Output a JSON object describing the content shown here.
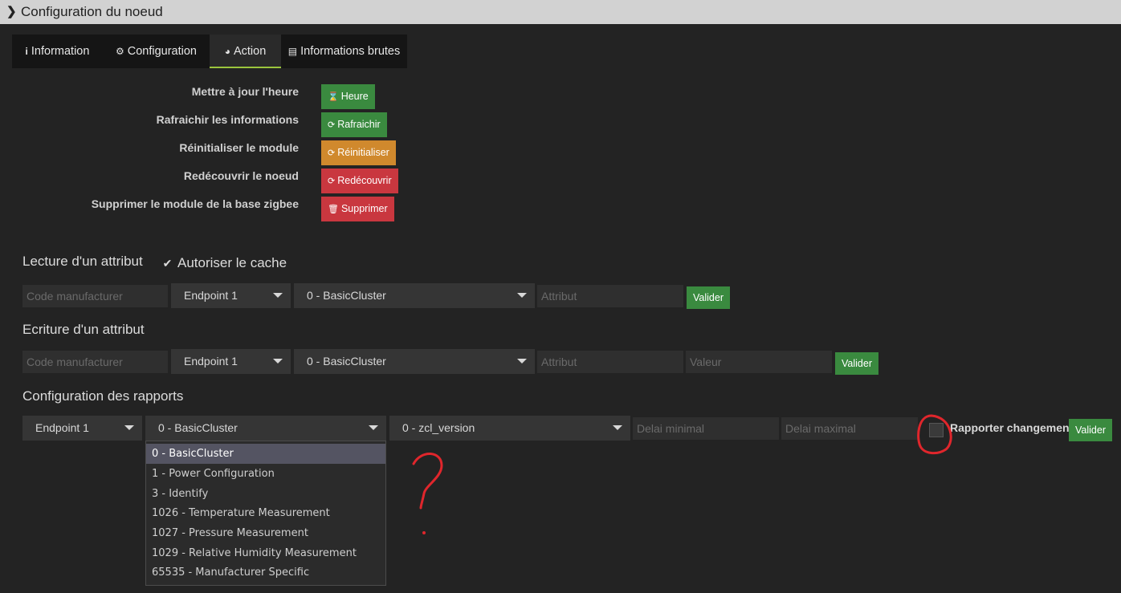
{
  "header": {
    "title": "Configuration du noeud"
  },
  "tabs": [
    {
      "label": "Information",
      "icon": "info-icon"
    },
    {
      "label": "Configuration",
      "icon": "gear-icon"
    },
    {
      "label": "Action",
      "icon": "dashboard-icon",
      "active": true
    },
    {
      "label": "Informations brutes",
      "icon": "list-icon"
    }
  ],
  "actions": [
    {
      "label": "Mettre à jour l'heure",
      "button": "Heure",
      "color": "#3a8a3f",
      "icon": "hourglass-icon"
    },
    {
      "label": "Rafraichir les informations",
      "button": "Rafraichir",
      "color": "#3a8a3f",
      "icon": "refresh-icon"
    },
    {
      "label": "Réinitialiser le module",
      "button": "Réinitialiser",
      "color": "#d0892d",
      "icon": "refresh-icon"
    },
    {
      "label": "Redécouvrir le noeud",
      "button": "Redécouvrir",
      "color": "#c9373f",
      "icon": "refresh-icon"
    },
    {
      "label": "Supprimer le module de la base zigbee",
      "button": "Supprimer",
      "color": "#c9373f",
      "icon": "trash-icon"
    }
  ],
  "read": {
    "title": "Lecture d'un attribut",
    "cache_label": "Autoriser le cache",
    "cache_checked": true,
    "manufacturer_placeholder": "Code manufacturer",
    "endpoint": "Endpoint 1",
    "cluster": "0 - BasicCluster",
    "attribute_placeholder": "Attribut",
    "submit": "Valider"
  },
  "write": {
    "title": "Ecriture d'un attribut",
    "manufacturer_placeholder": "Code manufacturer",
    "endpoint": "Endpoint 1",
    "cluster": "0 - BasicCluster",
    "attribute_placeholder": "Attribut",
    "value_placeholder": "Valeur",
    "submit": "Valider"
  },
  "report": {
    "title": "Configuration des rapports",
    "endpoint": "Endpoint 1",
    "cluster": "0 - BasicCluster",
    "attribute": "0 - zcl_version",
    "min_placeholder": "Delai minimal",
    "max_placeholder": "Delai maximal",
    "change_label": "Rapporter changement",
    "change_checked": false,
    "submit": "Valider"
  },
  "cluster_options": [
    "0 - BasicCluster",
    "1 - Power Configuration",
    "3 - Identify",
    "1026 - Temperature Measurement",
    "1027 - Pressure Measurement",
    "1029 - Relative Humidity Measurement",
    "65535 - Manufacturer Specific"
  ],
  "annotation_color": "#e0262c"
}
